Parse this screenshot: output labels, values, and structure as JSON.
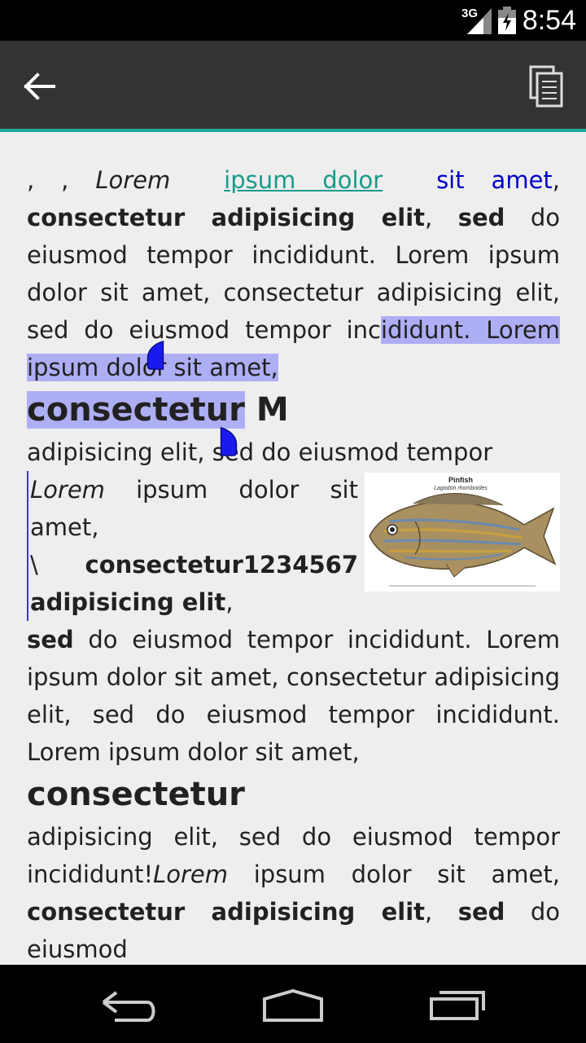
{
  "status_bar": {
    "time": "8:54",
    "network": "3G"
  },
  "app_bar": {
    "back_icon": "arrow-left-icon",
    "copy_icon": "copy-icon"
  },
  "document": {
    "p1_a": ", , ",
    "p1_italic": "Lorem",
    "p1_link": "ipsum dolor",
    "p1_blue": "sit amet",
    "p1_comma": ",",
    "p1_bold1": "consectetur adipisicing elit",
    "p1_comma2": ",",
    "p1_bold2": "sed",
    "p1_rest": " do eiusmod tempor incididunt. Lorem ipsum dolor sit amet, consectetur adipisicing elit, sed do eiusmod tempor inc",
    "p1_selected": "ididunt. Lorem ipsum dolor sit amet,",
    "h1_selected": "consectetur",
    "h1_rest": " M",
    "p2_line": "adipisicing elit, sed do eiusmod tempor",
    "quote_italic": "Lorem",
    "quote_text": " ipsum dolor sit amet,",
    "quote_slash": "\\",
    "quote_bold": "consectetur1234567 adipisicing elit",
    "quote_comma": ",",
    "p3_bold": "sed",
    "p3_rest": " do eiusmod tempor incididunt. Lorem ipsum dolor sit amet, consectetur adipisicing elit, sed do eiusmod tempor incididunt. Lorem ipsum dolor sit amet,",
    "h2": "consectetur",
    "p4_a": "adipisicing elit, sed do eiusmod tempor incididunt!",
    "p4_italic": "Lorem",
    "p4_b": " ipsum dolor sit amet,",
    "p4_bold1": "consectetur adipisicing elit",
    "p4_comma": ",",
    "p4_bold2": "sed",
    "p4_c": " do eiusmod"
  },
  "image": {
    "title": "Pinfish",
    "subtitle": "Lagodon rhomboides"
  },
  "nav_bar": {
    "back": "back-icon",
    "home": "home-icon",
    "recents": "recents-icon"
  },
  "colors": {
    "accent": "#1fa89a",
    "selection": "#aeaef5",
    "handle": "#1a1aee",
    "link": "#1a9a8a",
    "blue_text": "#0000cc"
  }
}
